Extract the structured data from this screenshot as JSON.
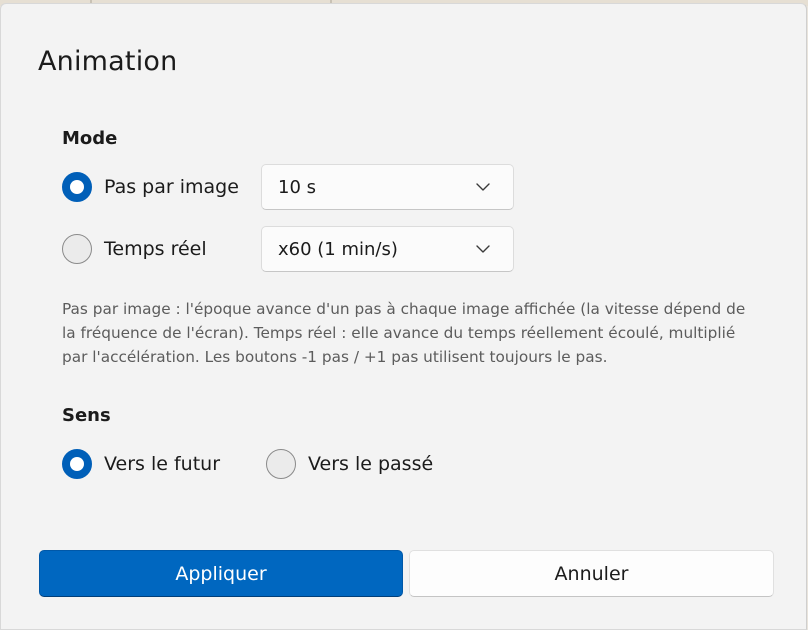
{
  "dialog": {
    "title": "Animation"
  },
  "mode": {
    "label": "Mode",
    "options": [
      {
        "label": "Pas par image",
        "selected": true,
        "dropdown_value": "10 s"
      },
      {
        "label": "Temps réel",
        "selected": false,
        "dropdown_value": "x60 (1 min/s)"
      }
    ],
    "help_text": "Pas par image : l'époque avance d'un pas à chaque image affichée (la vitesse dépend de la fréquence de l'écran). Temps réel : elle avance du temps réellement écoulé, multiplié par l'accélération. Les boutons -1 pas / +1 pas utilisent toujours le pas."
  },
  "direction": {
    "label": "Sens",
    "options": [
      {
        "label": "Vers le futur",
        "selected": true
      },
      {
        "label": "Vers le passé",
        "selected": false
      }
    ]
  },
  "buttons": {
    "apply_label": "Appliquer",
    "cancel_label": "Annuler"
  },
  "colors": {
    "accent": "#005fb8",
    "primary_button": "#0067c0",
    "dialog_background": "#f3f3f3"
  },
  "icons": {
    "dropdown": "chevron-down-icon"
  }
}
